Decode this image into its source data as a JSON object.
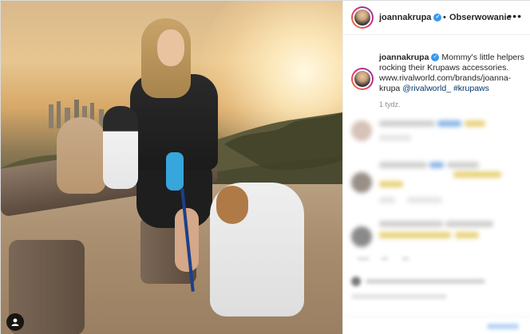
{
  "post": {
    "username": "joannakrupa",
    "follow_label": "Obserwowanie",
    "dot": "•",
    "more_icon": "more-dots-icon",
    "verified_icon": "verified-badge-icon"
  },
  "caption": {
    "username": "joannakrupa",
    "text": " Mommy's little helpers rocking their Krupaws accessories. www.rivalworld.com/brands/joanna-krupa ",
    "mention": "@rivalworld_",
    "hashtag": " #krupaws",
    "time": "1 tydz."
  },
  "photo": {
    "tag_icon": "user-tag-icon"
  },
  "colors": {
    "accent_link": "#00376b",
    "verified": "#3897f0",
    "text": "#262626",
    "muted": "#8e8e8e"
  }
}
